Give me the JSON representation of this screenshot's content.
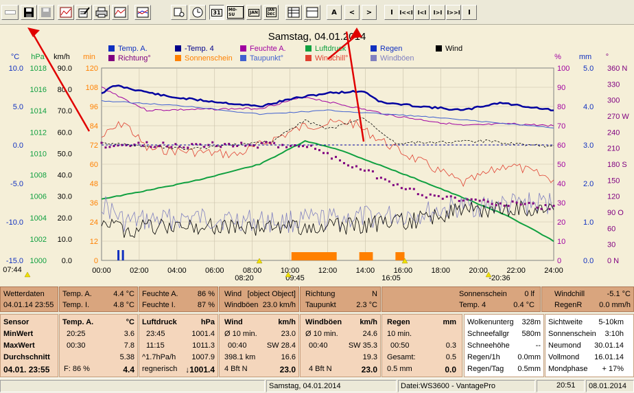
{
  "toolbar": {
    "buttons": [
      {
        "name": "back-button",
        "label": "",
        "x": 0
      },
      {
        "name": "save-button",
        "label": "",
        "x": 30
      },
      {
        "name": "save-disabled-button",
        "label": "",
        "x": 55
      },
      {
        "name": "image-button",
        "label": "",
        "x": 84
      },
      {
        "name": "edit-button",
        "label": "",
        "x": 110
      },
      {
        "name": "print-button",
        "label": "",
        "x": 136
      },
      {
        "name": "graph-button",
        "label": "",
        "x": 163
      },
      {
        "name": "graph2-button",
        "label": "",
        "x": 196
      }
    ],
    "view_buttons": [
      "31",
      "M0-SU",
      "JAN",
      "JAN DEC"
    ],
    "a_label": "A",
    "prev_label": "<",
    "next_label": ">",
    "nav_labels": [
      "I",
      "I<<I",
      "I<I",
      "I>I",
      "I>>I",
      "I"
    ]
  },
  "chart": {
    "title": "Samstag, 04.01.2014",
    "unit_labels": {
      "celsius": "°C",
      "hpa": "hPa",
      "kmh": "km/h",
      "min": "min",
      "percent": "%",
      "mm": "mm",
      "deg": "°"
    },
    "legend": [
      {
        "label": "Temp. A.",
        "color": "#1030c0"
      },
      {
        "label": "-Temp. 4",
        "color": "#00008b"
      },
      {
        "label": "Feuchte A.",
        "color": "#a000a0"
      },
      {
        "label": "Luftdruck",
        "color": "#10a040"
      },
      {
        "label": "Regen",
        "color": "#1030c0"
      },
      {
        "label": "Wind",
        "color": "#000000"
      },
      {
        "label": "Richtung°",
        "color": "#800080"
      },
      {
        "label": "Sonnenschein",
        "color": "#ff8000"
      },
      {
        "label": "Taupunkt°",
        "color": "#4060d0"
      },
      {
        "label": "Windchill°",
        "color": "#e04030"
      },
      {
        "label": "Windböen",
        "color": "#8080c0"
      }
    ],
    "axis_temp": [
      "10.0",
      "5.0",
      "0.0",
      "-5.0",
      "-10.0",
      "-15.0"
    ],
    "axis_hpa": [
      "1018",
      "1016",
      "1014",
      "1012",
      "1010",
      "1008",
      "1006",
      "1004",
      "1002",
      "1000"
    ],
    "axis_kmh": [
      "90.0",
      "80.0",
      "70.0",
      "60.0",
      "50.0",
      "40.0",
      "30.0",
      "20.0",
      "10.0",
      "0.0"
    ],
    "axis_min": [
      "120",
      "108",
      "96",
      "84",
      "72",
      "60",
      "48",
      "36",
      "24",
      "12",
      "0"
    ],
    "axis_pct": [
      "100",
      "90",
      "80",
      "70",
      "60",
      "50",
      "40",
      "30",
      "20",
      "10",
      "0"
    ],
    "axis_mm": [
      "5.0",
      "4.0",
      "3.0",
      "2.0",
      "1.0",
      "0.0"
    ],
    "axis_deg": [
      "360 N",
      "330",
      "300",
      "270 W",
      "240",
      "210",
      "180 S",
      "150",
      "120",
      "90 O",
      "60",
      "30",
      "0 N"
    ],
    "x_ticks": [
      "00:00",
      "02:00",
      "04:00",
      "06:00",
      "08:00",
      "10:00",
      "12:00",
      "14:00",
      "16:00",
      "18:00",
      "20:00",
      "22:00",
      "24:00"
    ],
    "sun_marks": [
      "07:44",
      "08:20",
      "09:45",
      "16:05",
      "-20:36"
    ]
  },
  "info": {
    "wetterdaten": "Wetterdaten",
    "date_time": "04.01.14 23:55",
    "temp_a_label": "Temp. A.",
    "temp_a": "4.4 °C",
    "temp_i_label": "Temp. I.",
    "temp_i": "4.8 °C",
    "feuchte_a_label": "Feuchte A.",
    "feuchte_a": "86 %",
    "feuchte_i_label": "Feuchte I.",
    "feuchte_i": "87 %",
    "wind_label": "Wind",
    "wind": {
      "title": "Wind",
      "unit": "km/h",
      "r1a": "Ø 10 min.",
      "r1b": "23.0",
      "r2a": "00:40",
      "r2b": "SW 28.4",
      "r3a": "398.1 km",
      "r3b": "16.6",
      "r4a": "4 Bft N",
      "r4b": "23.0"
    },
    "windboeen_label": "Windböen",
    "windboeen": "23.0 km/h",
    "richtung_label": "Richtung",
    "richtung": "N",
    "taupunkt_label": "Taupunkt",
    "taupunkt": "2.3 °C",
    "sonnenschein_label": "Sonnenschein",
    "sonnenschein": "0 lf",
    "temp4_label": "Temp. 4",
    "temp4": "0.4 °C",
    "windchill_label": "Windchill",
    "windchill": "-5.1 °C",
    "regenr_label": "RegenR",
    "regenr": "0.0 mm/h",
    "sensor": {
      "title": "Sensor",
      "min": "MinWert",
      "max": "MaxWert",
      "avg": "Durchschnitt",
      "now": "04.01. 23:55"
    },
    "tempa": {
      "title": "Temp. A.",
      "unit": "°C",
      "min_t": "20:25",
      "min_v": "3.6",
      "max_t": "00:30",
      "max_v": "7.8",
      "avg": "5.38",
      "f": "F: 86 %",
      "now": "4.4"
    },
    "druck": {
      "title": "Luftdruck",
      "unit": "hPa",
      "min_t": "23:45",
      "min_v": "1001.4",
      "max_t": "11:15",
      "max_v": "1011.3",
      "trend": "^1.7hPa/h",
      "avg": "1007.9",
      "reg": "regnerisch",
      "now": "↓1001.4"
    },
    "boeen": {
      "title": "Windböen",
      "unit": "km/h",
      "r1a": "Ø 10 min.",
      "r1b": "24.6",
      "r2a": "00:40",
      "r2b": "SW 35.3",
      "r3b": "19.3",
      "r4a": "4 Bft N",
      "r4b": "23.0"
    },
    "regen": {
      "title": "Regen",
      "unit": "mm",
      "r1a": "10 min.",
      "r2a": "00:50",
      "r2b": "0.3",
      "r3a": "Gesamt:",
      "r3b": "0.5",
      "r4a": "0.5 mm",
      "r4b": "0.0"
    },
    "wolken": {
      "a1": "Wolkenunterg",
      "b1": "328m",
      "a2": "Schneefallgr",
      "b2": "580m",
      "a3": "Schneehöhe",
      "b3": "--",
      "a4": "Regen/1h",
      "b4": "0.0mm",
      "a5": "Regen/Tag",
      "b5": "0.5mm"
    },
    "sicht": {
      "a1": "Sichtweite",
      "b1": "5-10km",
      "a2": "Sonnenschein",
      "b2": "3:10h",
      "a3": "Neumond",
      "b3": "30.01.14",
      "a4": "Vollmond",
      "b4": "16.01.14",
      "a5": "Mondphase",
      "b5": "+ 17%"
    }
  },
  "status": {
    "date": "Samstag, 04.01.2014",
    "file": "Datei:WS3600 - VantagePro",
    "time": "20:51",
    "date2": "08.01.2014"
  }
}
